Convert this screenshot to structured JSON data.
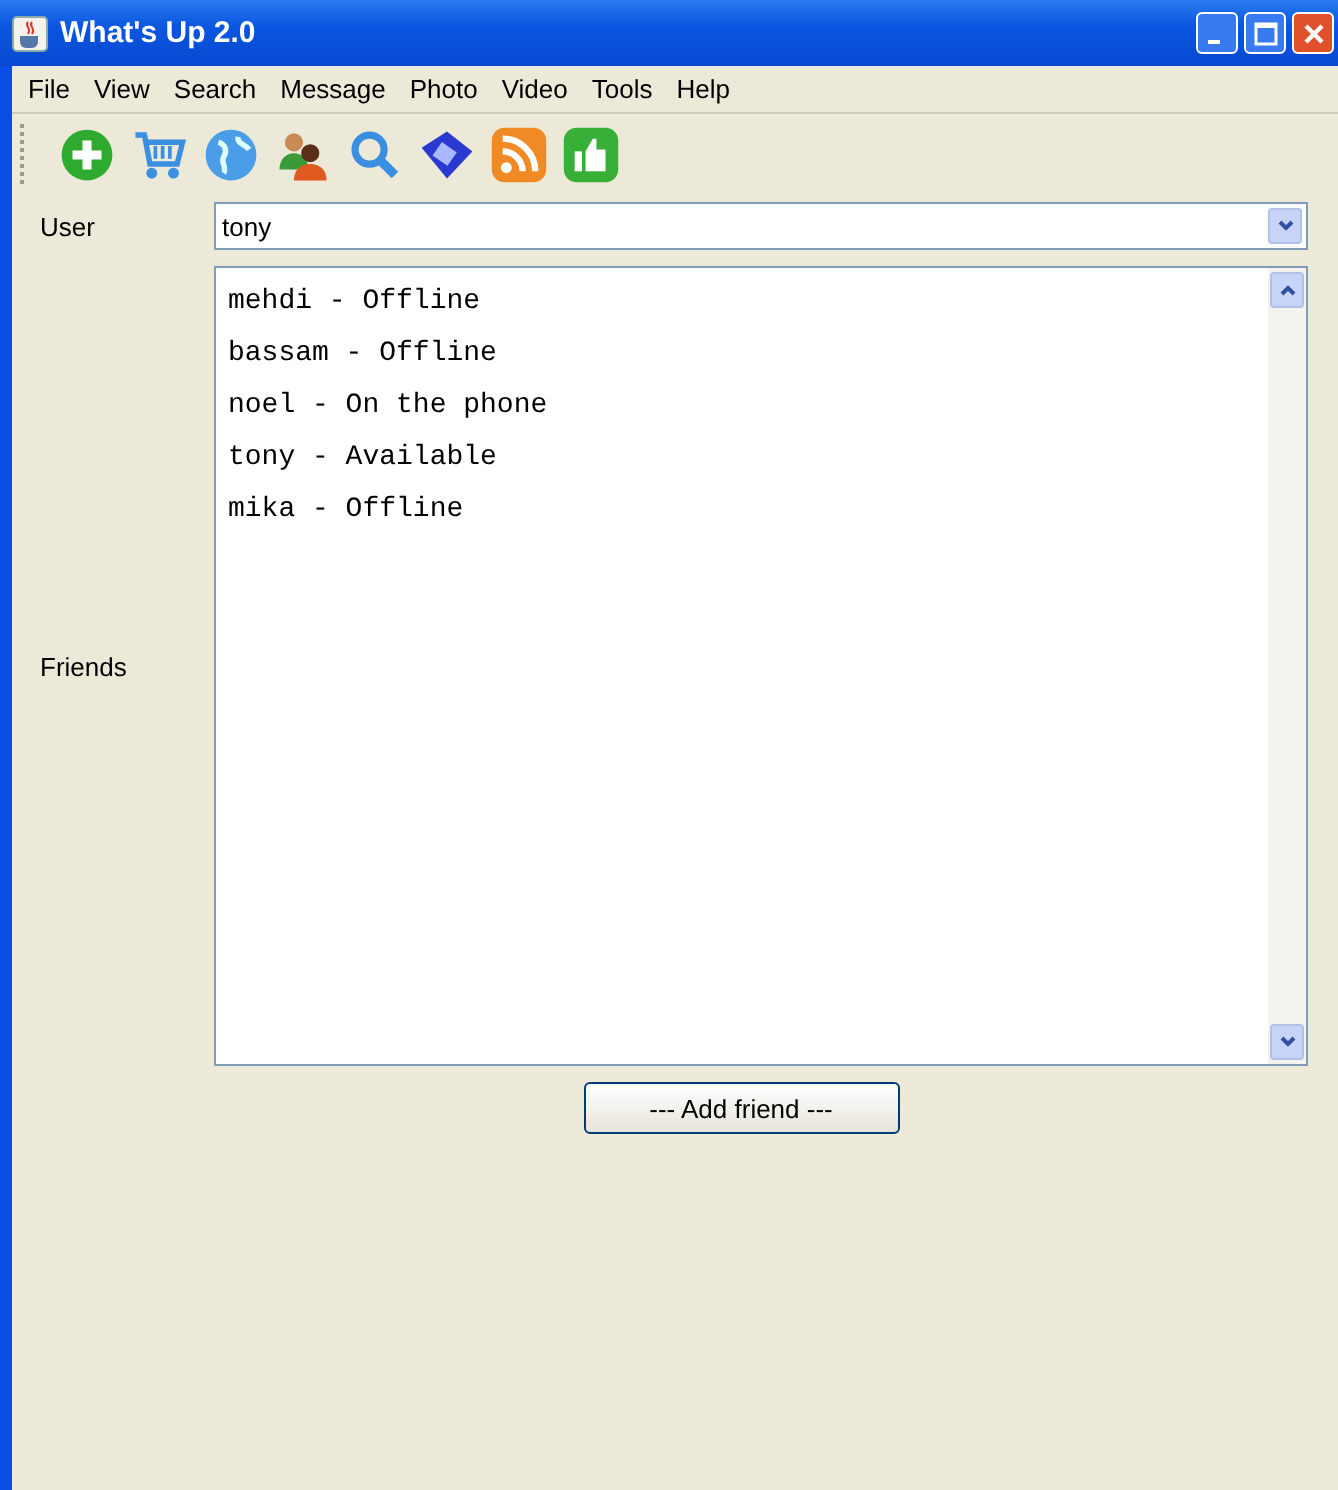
{
  "window": {
    "title": "What's Up 2.0"
  },
  "menu": [
    "File",
    "View",
    "Search",
    "Message",
    "Photo",
    "Video",
    "Tools",
    "Help"
  ],
  "user": {
    "label": "User",
    "value": "tony"
  },
  "friends": {
    "label": "Friends",
    "items": [
      "mehdi - Offline",
      "bassam - Offline",
      "noel - On the phone",
      "tony - Available",
      "mika - Offline"
    ]
  },
  "add_button": "--- Add friend ---"
}
